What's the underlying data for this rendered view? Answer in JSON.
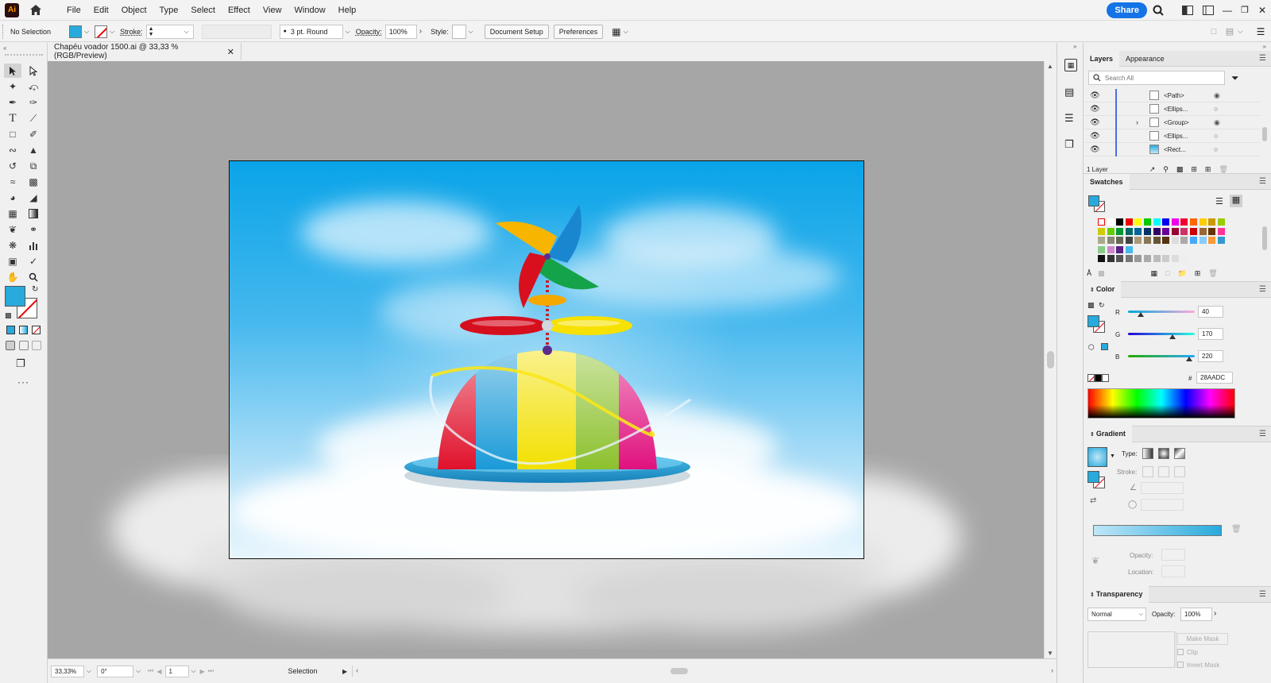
{
  "menubar": {
    "app_icon": "Ai",
    "items": [
      "File",
      "Edit",
      "Object",
      "Type",
      "Select",
      "Effect",
      "View",
      "Window",
      "Help"
    ],
    "share_label": "Share"
  },
  "controlbar": {
    "selection_label": "No Selection",
    "stroke_label": "Stroke:",
    "brush_value": "3 pt. Round",
    "opacity_label": "Opacity:",
    "opacity_value": "100%",
    "style_label": "Style:",
    "document_setup_label": "Document Setup",
    "preferences_label": "Preferences"
  },
  "document": {
    "tab_title": "Chapéu voador 1500.ai @ 33,33 % (RGB/Preview)"
  },
  "statusbar": {
    "zoom_value": "33,33%",
    "rotation_value": "0°",
    "artboard_number": "1",
    "tool_name": "Selection"
  },
  "layers_panel": {
    "tabs": [
      "Layers",
      "Appearance"
    ],
    "search_placeholder": "Search All",
    "rows": [
      "<Path>",
      "<Ellips...",
      "<Group>",
      "<Ellips...",
      "<Rect..."
    ],
    "footer_label": "1 Layer"
  },
  "swatches_panel": {
    "title": "Swatches"
  },
  "color_panel": {
    "title": "Color",
    "r_label": "R",
    "r_value": "40",
    "g_label": "G",
    "g_value": "170",
    "b_label": "B",
    "b_value": "220",
    "hex_prefix": "#",
    "hex_value": "28AADC"
  },
  "gradient_panel": {
    "title": "Gradient",
    "type_label": "Type:",
    "stroke_label": "Stroke:",
    "opacity_label": "Opacity:",
    "location_label": "Location:"
  },
  "transparency_panel": {
    "title": "Transparency",
    "blend_mode": "Normal",
    "opacity_label": "Opacity:",
    "opacity_value": "100%",
    "make_mask_label": "Make Mask",
    "clip_label": "Clip",
    "invert_mask_label": "Invert Mask"
  },
  "colors": {
    "fill": "#28AADC",
    "accent": "#1473E6"
  }
}
